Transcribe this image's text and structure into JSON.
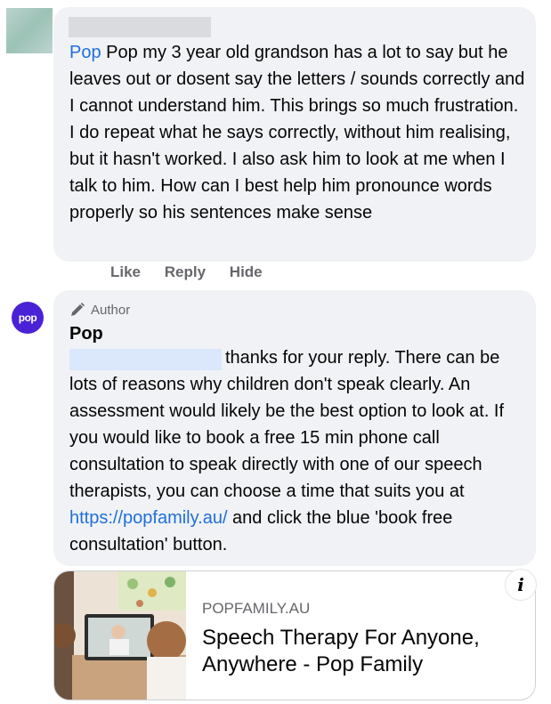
{
  "comment1": {
    "mention": "Pop",
    "text": " Pop my 3 year old grandson has a lot to say but he leaves out or dosent say the letters / sounds correctly and I cannot understand him. This brings so much frustration. I do repeat what he says correctly, without him realising, but it hasn't worked. I also ask him to look at me when I talk to him. How can I best help him pronounce words properly so his sentences make sense"
  },
  "actions": {
    "like": "Like",
    "reply": "Reply",
    "hide": "Hide"
  },
  "reply": {
    "avatar_text": "pop",
    "badge": "Author",
    "name": "Pop",
    "text_before": "thanks for your reply. There can be lots of reasons why children don't speak clearly. An assessment would likely be the best option to look at. If you would like to book a free 15 min phone call consultation to speak directly with one of our speech therapists, you can choose a time that suits you at ",
    "link": "https://popfamily.au/",
    "text_after": " and click the blue 'book free consultation' button."
  },
  "link_card": {
    "domain": "POPFAMILY.AU",
    "title": "Speech Therapy For Anyone, Anywhere - Pop Family",
    "info_icon": "i"
  },
  "colors": {
    "bubble_bg": "#f0f2f5",
    "link": "#216fdb",
    "secondary_text": "#65676b",
    "avatar_brand": "#4a22d6"
  }
}
